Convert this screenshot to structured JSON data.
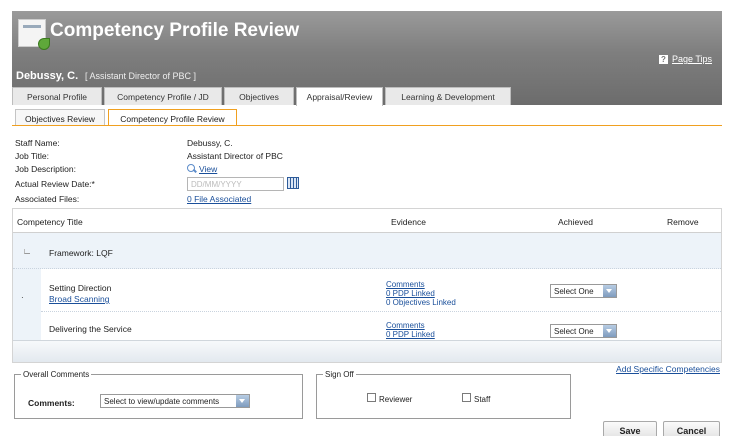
{
  "header": {
    "title": "Competency Profile Review",
    "page_tips": "Page Tips",
    "staff_name": "Debussy, C.",
    "staff_role": "[ Assistant Director of PBC ]",
    "bg_color": "#7e7e7e"
  },
  "main_tabs": [
    {
      "label": "Personal Profile",
      "active": false
    },
    {
      "label": "Competency Profile / JD",
      "active": false
    },
    {
      "label": "Objectives",
      "active": false
    },
    {
      "label": "Appraisal/Review",
      "active": true
    },
    {
      "label": "Learning & Development",
      "active": false
    }
  ],
  "sub_tabs": [
    {
      "label": "Objectives Review",
      "active": false
    },
    {
      "label": "Competency Profile Review",
      "active": true
    }
  ],
  "info": {
    "staff_name_label": "Staff Name:",
    "staff_name_value": "Debussy, C.",
    "job_title_label": "Job Title:",
    "job_title_value": "Assistant Director of PBC",
    "job_description_label": "Job Description:",
    "job_description_link": "View",
    "review_date_label": "Actual Review Date:*",
    "review_date_placeholder": "DD/MM/YYYY",
    "associated_files_label": "Associated Files:",
    "associated_files_link": "0 File Associated"
  },
  "grid": {
    "columns": {
      "title": "Competency Title",
      "evidence": "Evidence",
      "achieved": "Achieved",
      "remove": "Remove"
    },
    "framework": "Framework: LQF",
    "rows": [
      {
        "title": "Setting Direction",
        "subtitle": "Broad Scanning",
        "evidence": [
          "Comments",
          "0 PDP Linked",
          "0 Objectives Linked"
        ],
        "achieved": "Select One"
      },
      {
        "title": "Delivering the Service",
        "subtitle": "",
        "evidence": [
          "Comments",
          "0 PDP Linked"
        ],
        "achieved": "Select One"
      }
    ]
  },
  "add_specific": "Add Specific Competencies",
  "overall_comments": {
    "legend": "Overall Comments",
    "label": "Comments:",
    "select_value": "Select to view/update comments"
  },
  "sign_off": {
    "legend": "Sign Off",
    "reviewer_label": "Reviewer",
    "staff_label": "Staff",
    "reviewer_checked": false,
    "staff_checked": false
  },
  "buttons": {
    "save": "Save",
    "cancel": "Cancel"
  }
}
